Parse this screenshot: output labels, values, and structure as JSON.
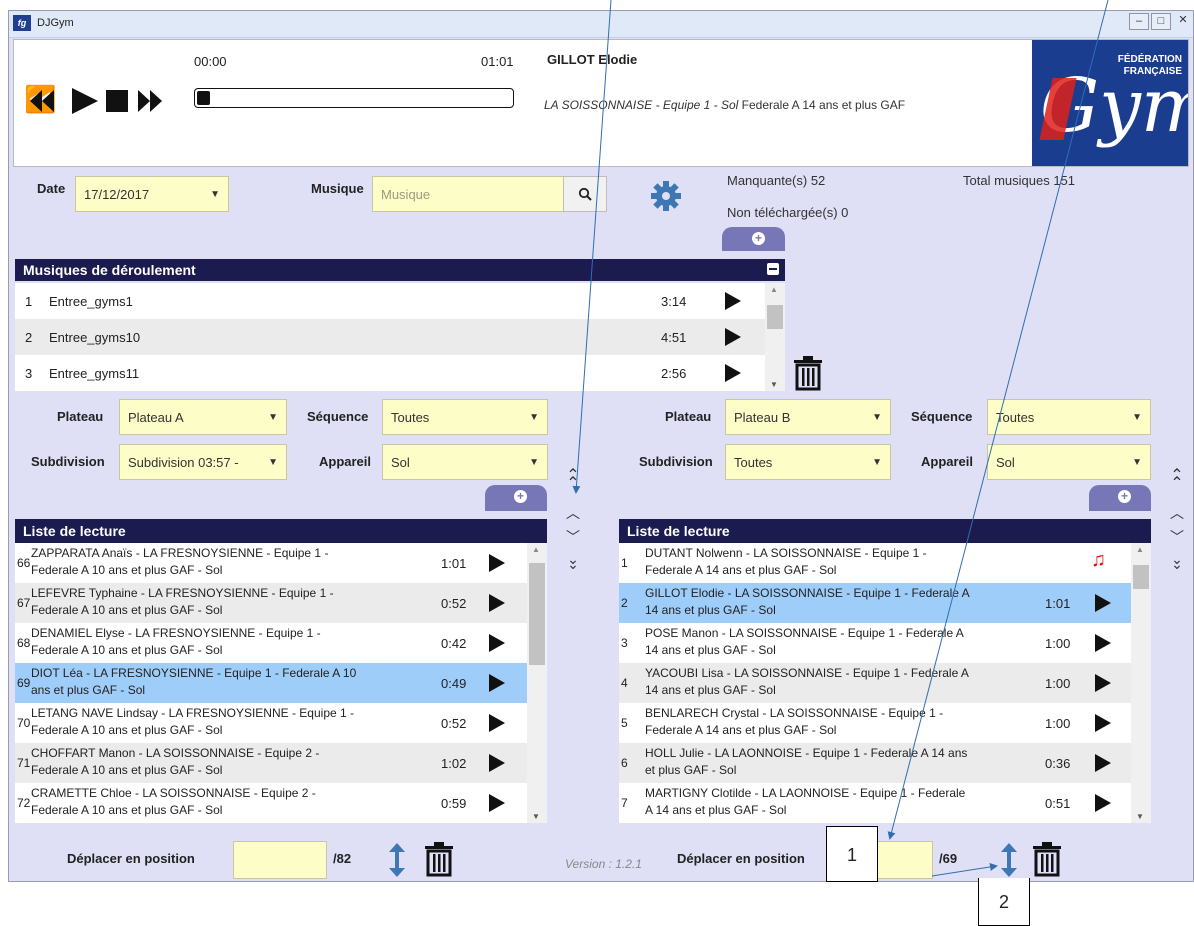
{
  "app": {
    "title": "DJGym"
  },
  "player": {
    "time_start": "00:00",
    "time_end": "01:01",
    "progress": 0.04,
    "athlete": "GILLOT Elodie",
    "detail_italic": "LA SOISSONNAISE - Equipe 1 - Sol",
    "detail_rest": " Federale A 14 ans et plus GAF",
    "brand_line1": "FÉDÉRATION",
    "brand_line2": "FRANÇAISE",
    "brand_word": "Gym"
  },
  "filters": {
    "date_label": "Date",
    "date_value": "17/12/2017",
    "music_label": "Musique",
    "music_placeholder": "Musique",
    "missing": "Manquante(s) 52",
    "not_downloaded": "Non téléchargée(s) 0",
    "total": "Total musiques 151"
  },
  "deroulement": {
    "header": "Musiques de déroulement",
    "rows": [
      {
        "num": "1",
        "name": "Entree_gyms1",
        "duration": "3:14"
      },
      {
        "num": "2",
        "name": "Entree_gyms10",
        "duration": "4:51"
      },
      {
        "num": "3",
        "name": "Entree_gyms11",
        "duration": "2:56"
      }
    ]
  },
  "left": {
    "plateau_label": "Plateau",
    "plateau_value": "Plateau A",
    "sequence_label": "Séquence",
    "sequence_value": "Toutes",
    "subdivision_label": "Subdivision",
    "subdivision_value": "Subdivision 03:57 -",
    "appareil_label": "Appareil",
    "appareil_value": "Sol",
    "list_header": "Liste de lecture",
    "items": [
      {
        "num": "66",
        "line1": "ZAPPARATA Anaïs - LA FRESNOYSIENNE - Equipe 1 -",
        "line2": "Federale A 10 ans et plus GAF - Sol",
        "duration": "1:01",
        "selected": false
      },
      {
        "num": "67",
        "line1": "LEFEVRE Typhaine - LA FRESNOYSIENNE - Equipe 1 -",
        "line2": "Federale A 10 ans et plus GAF - Sol",
        "duration": "0:52",
        "selected": false
      },
      {
        "num": "68",
        "line1": "DENAMIEL Elyse - LA FRESNOYSIENNE - Equipe 1 -",
        "line2": "Federale A 10 ans et plus GAF - Sol",
        "duration": "0:42",
        "selected": false
      },
      {
        "num": "69",
        "line1": "DIOT Léa - LA FRESNOYSIENNE - Equipe 1 - Federale A 10",
        "line2": "ans et plus GAF - Sol",
        "duration": "0:49",
        "selected": true
      },
      {
        "num": "70",
        "line1": "LETANG NAVE Lindsay - LA FRESNOYSIENNE - Equipe 1 -",
        "line2": "Federale A 10 ans et plus GAF - Sol",
        "duration": "0:52",
        "selected": false
      },
      {
        "num": "71",
        "line1": "CHOFFART Manon - LA SOISSONNAISE - Equipe 2 -",
        "line2": "Federale A 10 ans et plus GAF - Sol",
        "duration": "1:02",
        "selected": false
      },
      {
        "num": "72",
        "line1": "CRAMETTE Chloe - LA SOISSONNAISE - Equipe 2 -",
        "line2": "Federale A 10 ans et plus GAF - Sol",
        "duration": "0:59",
        "selected": false
      }
    ],
    "move_label": "Déplacer en position",
    "move_total": "/82"
  },
  "right": {
    "plateau_label": "Plateau",
    "plateau_value": "Plateau B",
    "sequence_label": "Séquence",
    "sequence_value": "Toutes",
    "subdivision_label": "Subdivision",
    "subdivision_value": "Toutes",
    "appareil_label": "Appareil",
    "appareil_value": "Sol",
    "list_header": "Liste de lecture",
    "items": [
      {
        "num": "1",
        "line1": "DUTANT Nolwenn - LA SOISSONNAISE - Equipe 1 -",
        "line2": "Federale A 14 ans et plus GAF - Sol",
        "duration": "",
        "selected": false,
        "icon": "music-note"
      },
      {
        "num": "2",
        "line1": "GILLOT Elodie - LA SOISSONNAISE - Equipe 1 - Federale A",
        "line2": "14 ans et plus GAF - Sol",
        "duration": "1:01",
        "selected": true
      },
      {
        "num": "3",
        "line1": "POSE Manon - LA SOISSONNAISE - Equipe 1 - Federale A",
        "line2": "14 ans et plus GAF - Sol",
        "duration": "1:00",
        "selected": false
      },
      {
        "num": "4",
        "line1": "YACOUBI Lisa - LA SOISSONNAISE - Equipe 1 - Federale A",
        "line2": "14 ans et plus GAF - Sol",
        "duration": "1:00",
        "selected": false
      },
      {
        "num": "5",
        "line1": "BENLARECH Crystal - LA SOISSONNAISE - Equipe 1 -",
        "line2": "Federale A 14 ans et plus GAF - Sol",
        "duration": "1:00",
        "selected": false
      },
      {
        "num": "6",
        "line1": "HOLL Julie - LA LAONNOISE - Equipe 1 - Federale A 14 ans",
        "line2": "et plus GAF - Sol",
        "duration": "0:36",
        "selected": false
      },
      {
        "num": "7",
        "line1": "MARTIGNY Clotilde - LA LAONNOISE - Equipe 1 - Federale",
        "line2": "A 14 ans et plus GAF - Sol",
        "duration": "0:51",
        "selected": false
      }
    ],
    "move_label": "Déplacer en position",
    "move_total": "/69"
  },
  "version": "Version : 1.2.1",
  "callouts": {
    "one": "1",
    "two": "2"
  },
  "colors": {
    "header": "#1b1b50",
    "selected": "#9fcdfa",
    "field": "#fdfdc8",
    "accent": "#3d78b5",
    "tab": "#7777b8",
    "note": "#e01010"
  }
}
